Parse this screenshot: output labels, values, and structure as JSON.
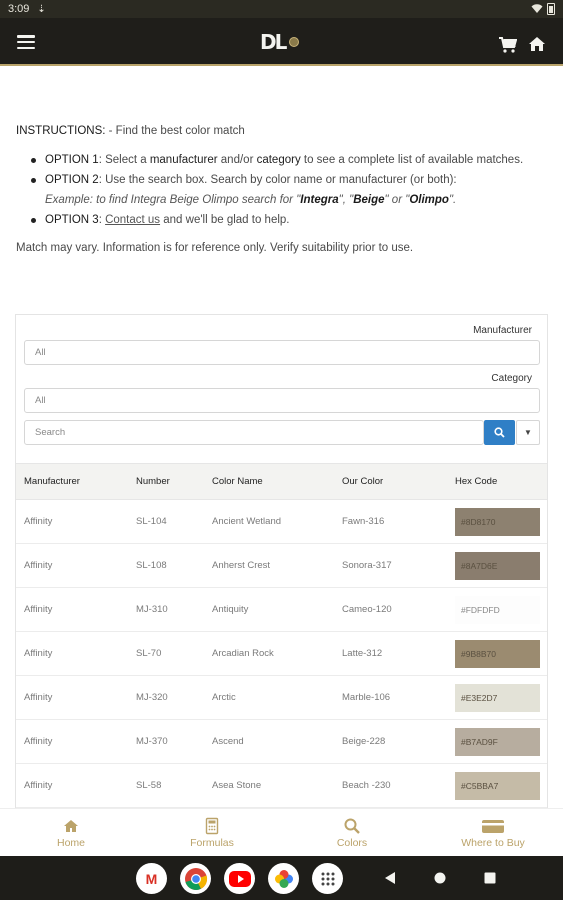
{
  "status_bar": {
    "time": "3:09"
  },
  "nav": {
    "home_label": "Home",
    "formulas_label": "Formulas",
    "colors_label": "Colors",
    "where_label": "Where to Buy"
  },
  "instructions": {
    "head": "INSTRUCTIONS:",
    "intro": " - Find the best color match",
    "opt1_label": "OPTION 1",
    "opt1_a": ": Select a ",
    "opt1_manufacturer": "manufacturer",
    "opt1_b": " and/or ",
    "opt1_category": "category",
    "opt1_c": " to see a complete list of available matches.",
    "opt2_label": "OPTION 2",
    "opt2_text": ": Use the search box. Search by color name or manufacturer (or both):",
    "example_a": "Example: to find Integra Beige Olimpo search for \"",
    "example_integra": "Integra",
    "example_b": "\", \"",
    "example_beige": "Beige",
    "example_c": "\" or \"",
    "example_olimpo": "Olimpo",
    "example_d": "\".",
    "opt3_label": "OPTION 3",
    "opt3_a": ": ",
    "opt3_link": "Contact us",
    "opt3_b": " and we'll be glad to help.",
    "note": "Match may vary. Information is for reference only. Verify suitability prior to use."
  },
  "filters": {
    "manufacturer_label": "Manufacturer",
    "manufacturer_value": "All",
    "category_label": "Category",
    "category_value": "All",
    "search_placeholder": "Search"
  },
  "table": {
    "headers": [
      "Manufacturer",
      "Number",
      "Color Name",
      "Our Color",
      "Hex Code"
    ],
    "rows": [
      {
        "manufacturer": "Affinity",
        "number": "SL-104",
        "name": "Ancient Wetland",
        "our": "Fawn-316",
        "hex": "#8D8170",
        "color": "#8D8170"
      },
      {
        "manufacturer": "Affinity",
        "number": "SL-108",
        "name": "Anherst Crest",
        "our": "Sonora-317",
        "hex": "#8A7D6E",
        "color": "#8A7D6E"
      },
      {
        "manufacturer": "Affinity",
        "number": "MJ-310",
        "name": "Antiquity",
        "our": "Cameo-120",
        "hex": "#FDFDFD",
        "color": "#FDFDFD"
      },
      {
        "manufacturer": "Affinity",
        "number": "SL-70",
        "name": "Arcadian Rock",
        "our": "Latte-312",
        "hex": "#9B8B70",
        "color": "#9B8B70"
      },
      {
        "manufacturer": "Affinity",
        "number": "MJ-320",
        "name": "Arctic",
        "our": "Marble-106",
        "hex": "#E3E2D7",
        "color": "#E3E2D7"
      },
      {
        "manufacturer": "Affinity",
        "number": "MJ-370",
        "name": "Ascend",
        "our": "Beige-228",
        "hex": "#B7AD9F",
        "color": "#B7AD9F"
      },
      {
        "manufacturer": "Affinity",
        "number": "SL-58",
        "name": "Asea Stone",
        "our": "Beach -230",
        "hex": "#C5BBA7",
        "color": "#C5BBA7"
      }
    ]
  },
  "colors": {
    "accent_gold": "#BBA36A",
    "header_dark": "#1F1E1A",
    "search_blue": "#2F7FC6"
  }
}
